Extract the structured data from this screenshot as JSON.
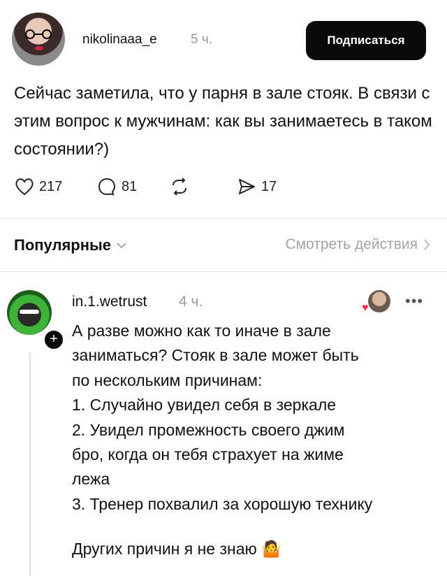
{
  "post": {
    "username": "nikolinaaa_e",
    "time": "5 ч.",
    "follow_label": "Подписаться",
    "text": "Сейчас заметила, что у парня в зале стояк. В связи с этим вопрос к мужчинам: как вы занимаетесь в таком состоянии?)",
    "likes": "217",
    "comments": "81",
    "shares": "17"
  },
  "filter": {
    "sort_label": "Популярные",
    "view_actions_label": "Смотреть действия"
  },
  "reply": {
    "username": "in.1.wetrust",
    "time": "4 ч.",
    "lines": [
      "А разве можно как то иначе в зале",
      "заниматься? Стояк в зале может быть",
      "по нескольким причинам:",
      "1. Случайно увидел себя в зеркале",
      "2. Увидел промежность своего джим",
      "бро, когда он тебя страхует на жиме",
      "лежа",
      "3. Тренер похвалил за хорошую технику"
    ],
    "closing": "Других причин я не знаю 🤷"
  },
  "icons": {
    "like": "heart-icon",
    "comment": "comment-icon",
    "repost": "repost-icon",
    "share": "send-icon",
    "more": "more-icon"
  }
}
